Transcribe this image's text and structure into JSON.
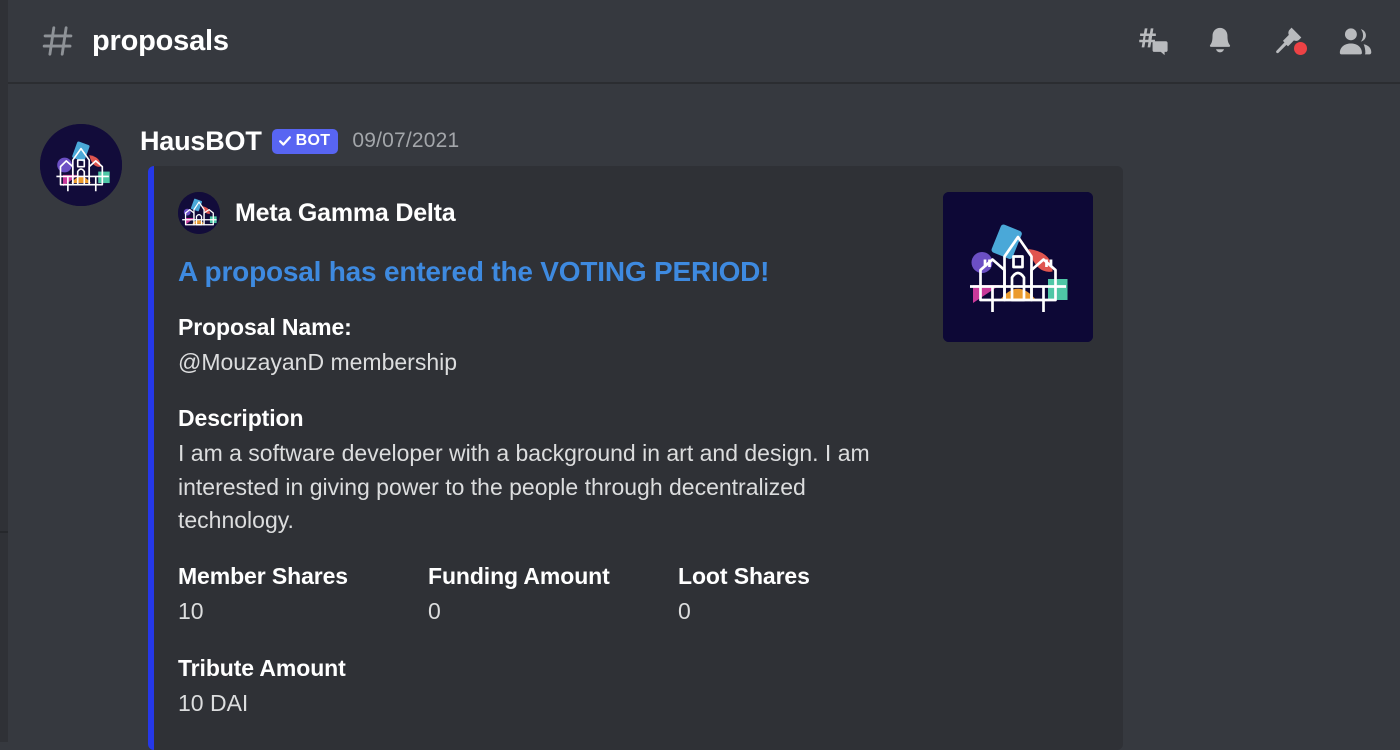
{
  "header": {
    "hash_icon": "hash-icon",
    "channel_name": "proposals",
    "actions": [
      {
        "name": "threads-icon",
        "label": "Threads"
      },
      {
        "name": "bell-icon",
        "label": "Notification Settings"
      },
      {
        "name": "pin-icon",
        "label": "Pinned Messages"
      },
      {
        "name": "members-icon",
        "label": "Member List"
      }
    ]
  },
  "message": {
    "username": "HausBOT",
    "bot_badge": "BOT",
    "timestamp": "09/07/2021",
    "avatar_alt": "daohaus-castle-logo"
  },
  "embed": {
    "accent_color": "#2538e8",
    "background_color": "#2f3136",
    "author": "Meta Gamma Delta",
    "title": "A proposal has entered the VOTING PERIOD!",
    "title_color": "#3e8ae0",
    "thumbnail_alt": "daohaus-castle-logo",
    "fields": [
      {
        "name": "Proposal Name:",
        "value": "@MouzayanD membership",
        "inline": false
      },
      {
        "name": "Description",
        "value": "I am a software developer with a background in art and design. I am interested in giving power to the people through decentralized technology.",
        "inline": false
      },
      {
        "name": "Member Shares",
        "value": "10",
        "inline": true
      },
      {
        "name": "Funding Amount",
        "value": "0",
        "inline": true
      },
      {
        "name": "Loot Shares",
        "value": "0",
        "inline": true
      },
      {
        "name": "Tribute Amount",
        "value": "10 DAI",
        "inline": false
      }
    ]
  }
}
